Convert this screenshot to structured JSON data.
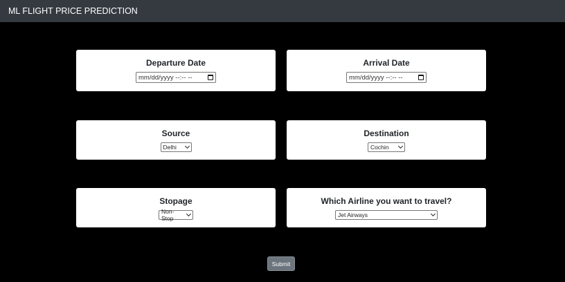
{
  "navbar": {
    "title": "ML FLIGHT PRICE PREDICTION"
  },
  "form": {
    "departure": {
      "label": "Departure Date",
      "value": "mm/dd/yyyy --:-- --"
    },
    "arrival": {
      "label": "Arrival Date",
      "value": "mm/dd/yyyy --:-- --"
    },
    "source": {
      "label": "Source",
      "selected": "Delhi"
    },
    "destination": {
      "label": "Destination",
      "selected": "Cochin"
    },
    "stopage": {
      "label": "Stopage",
      "selected": "Non-Stop"
    },
    "airline": {
      "label": "Which Airline you want to travel?",
      "selected": "Jet Airways"
    },
    "submit_label": "Submit"
  },
  "colors": {
    "background": "#000000",
    "navbar": "#343a40",
    "card": "#ffffff",
    "submit_button": "#6c757d"
  },
  "icons": [
    "calendar-icon",
    "chevron-down-icon"
  ]
}
